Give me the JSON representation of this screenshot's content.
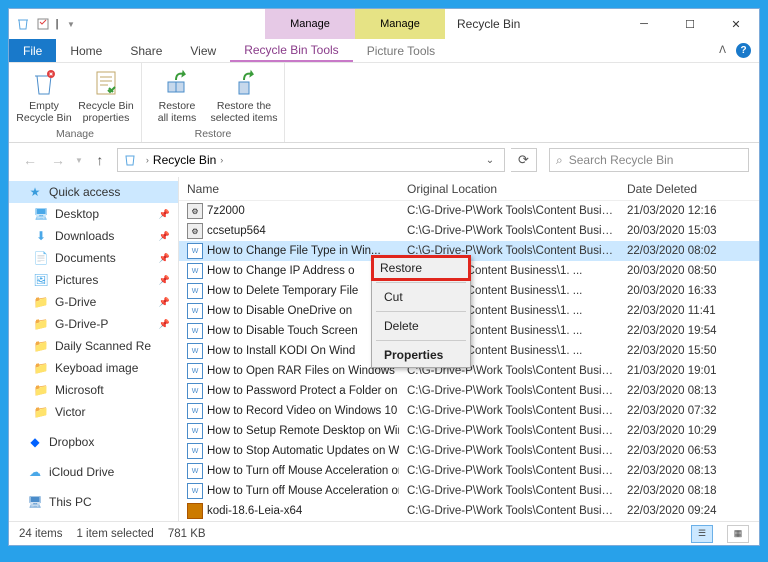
{
  "title": "Recycle Bin",
  "context_tabs": {
    "rb": "Manage",
    "pic": "Manage"
  },
  "ribbon_tabs": {
    "file": "File",
    "home": "Home",
    "share": "Share",
    "view": "View",
    "rbtools": "Recycle Bin Tools",
    "pictools": "Picture Tools"
  },
  "ribbon": {
    "manage": {
      "empty": "Empty\nRecycle Bin",
      "props": "Recycle Bin\nproperties",
      "title": "Manage"
    },
    "restore": {
      "all": "Restore\nall items",
      "sel": "Restore the\nselected items",
      "title": "Restore"
    }
  },
  "breadcrumb": {
    "root": "Recycle Bin"
  },
  "search": {
    "placeholder": "Search Recycle Bin"
  },
  "sidebar": {
    "quick": "Quick access",
    "items": [
      {
        "label": "Desktop",
        "icon": "desktop",
        "pin": true
      },
      {
        "label": "Downloads",
        "icon": "downloads",
        "pin": true
      },
      {
        "label": "Documents",
        "icon": "documents",
        "pin": true
      },
      {
        "label": "Pictures",
        "icon": "pictures",
        "pin": true
      },
      {
        "label": "G-Drive",
        "icon": "folder",
        "pin": true
      },
      {
        "label": "G-Drive-P",
        "icon": "folder",
        "pin": true
      },
      {
        "label": "Daily Scanned Re",
        "icon": "folder",
        "pin": false
      },
      {
        "label": "Keyboad image",
        "icon": "folder",
        "pin": false
      },
      {
        "label": "Microsoft",
        "icon": "folder",
        "pin": false
      },
      {
        "label": "Victor",
        "icon": "folder",
        "pin": false
      }
    ],
    "dropbox": "Dropbox",
    "icloud": "iCloud Drive",
    "thispc": "This PC"
  },
  "columns": {
    "name": "Name",
    "orig": "Original Location",
    "date": "Date Deleted"
  },
  "files": [
    {
      "name": "7z2000",
      "type": "app",
      "orig": "C:\\G-Drive-P\\Work Tools\\Content Business\\1. ...",
      "date": "21/03/2020 12:16"
    },
    {
      "name": "ccsetup564",
      "type": "app",
      "orig": "C:\\G-Drive-P\\Work Tools\\Content Business\\1. ...",
      "date": "20/03/2020 15:03"
    },
    {
      "name": "How to Change File Type in Win...",
      "type": "doc",
      "orig": "C:\\G-Drive-P\\Work Tools\\Content Business\\1. ...",
      "date": "22/03/2020 08:02",
      "selected": true
    },
    {
      "name": "How to Change IP Address o",
      "type": "doc",
      "orig": "Work Tools\\Content Business\\1. ...",
      "date": "20/03/2020 08:50"
    },
    {
      "name": "How to Delete Temporary File",
      "type": "doc",
      "orig": "Work Tools\\Content Business\\1. ...",
      "date": "20/03/2020 16:33"
    },
    {
      "name": "How to Disable OneDrive on",
      "type": "doc",
      "orig": "Work Tools\\Content Business\\1. ...",
      "date": "22/03/2020 11:41"
    },
    {
      "name": "How to Disable Touch Screen",
      "type": "doc",
      "orig": "Work Tools\\Content Business\\1. ...",
      "date": "22/03/2020 19:54"
    },
    {
      "name": "How to Install KODI On Wind",
      "type": "doc",
      "orig": "Work Tools\\Content Business\\1. ...",
      "date": "22/03/2020 15:50"
    },
    {
      "name": "How to Open RAR Files on Windows 10",
      "type": "doc",
      "orig": "C:\\G-Drive-P\\Work Tools\\Content Business\\1. ...",
      "date": "21/03/2020 19:01"
    },
    {
      "name": "How to Password Protect a Folder on Wi...",
      "type": "doc",
      "orig": "C:\\G-Drive-P\\Work Tools\\Content Business\\1. ...",
      "date": "22/03/2020 08:13"
    },
    {
      "name": "How to Record Video on Windows 10",
      "type": "doc",
      "orig": "C:\\G-Drive-P\\Work Tools\\Content Business\\1. ...",
      "date": "22/03/2020 07:32"
    },
    {
      "name": "How to Setup Remote Desktop on Win...",
      "type": "doc",
      "orig": "C:\\G-Drive-P\\Work Tools\\Content Business\\1. ...",
      "date": "22/03/2020 10:29"
    },
    {
      "name": "How to Stop Automatic Updates on Win...",
      "type": "doc",
      "orig": "C:\\G-Drive-P\\Work Tools\\Content Business\\1. ...",
      "date": "22/03/2020 06:53"
    },
    {
      "name": "How to Turn off Mouse Acceleration on ...",
      "type": "doc",
      "orig": "C:\\G-Drive-P\\Work Tools\\Content Business\\1. ...",
      "date": "22/03/2020 08:13"
    },
    {
      "name": "How to Turn off Mouse Acceleration on ...",
      "type": "doc",
      "orig": "C:\\G-Drive-P\\Work Tools\\Content Business\\1. ...",
      "date": "22/03/2020 08:18"
    },
    {
      "name": "kodi-18.6-Leia-x64",
      "type": "rar",
      "orig": "C:\\G-Drive-P\\Work Tools\\Content Business\\1. ...",
      "date": "22/03/2020 09:24"
    }
  ],
  "context_menu": {
    "restore": "Restore",
    "cut": "Cut",
    "delete": "Delete",
    "properties": "Properties"
  },
  "status": {
    "count": "24 items",
    "sel": "1 item selected",
    "size": "781 KB"
  }
}
